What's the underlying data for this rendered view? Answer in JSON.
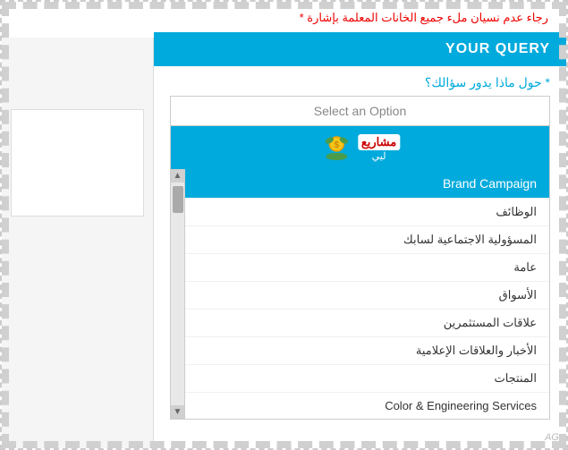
{
  "page": {
    "warning_text": "رجاء عدم نسيان ملء جميع الخانات المعلمة بإشارة *",
    "section_header": "YOUR QUERY",
    "question_label": "* حول ماذا يدور سؤالك؟",
    "select_placeholder": "Select an Option",
    "dropdown": {
      "logo_text": "مشاريع ليي",
      "options": [
        {
          "label": "Brand Campaign",
          "highlighted": true
        },
        {
          "label": "الوظائف",
          "highlighted": false
        },
        {
          "label": "المسؤولية الاجتماعية لسابك",
          "highlighted": false
        },
        {
          "label": "عامة",
          "highlighted": false
        },
        {
          "label": "الأسواق",
          "highlighted": false
        },
        {
          "label": "علاقات المستثمرين",
          "highlighted": false
        },
        {
          "label": "الأخبار والعلاقات الإعلامية",
          "highlighted": false
        },
        {
          "label": "المنتجات",
          "highlighted": false
        },
        {
          "label": "Color & Engineering Services",
          "highlighted": false
        }
      ]
    },
    "watermark": "AG"
  }
}
